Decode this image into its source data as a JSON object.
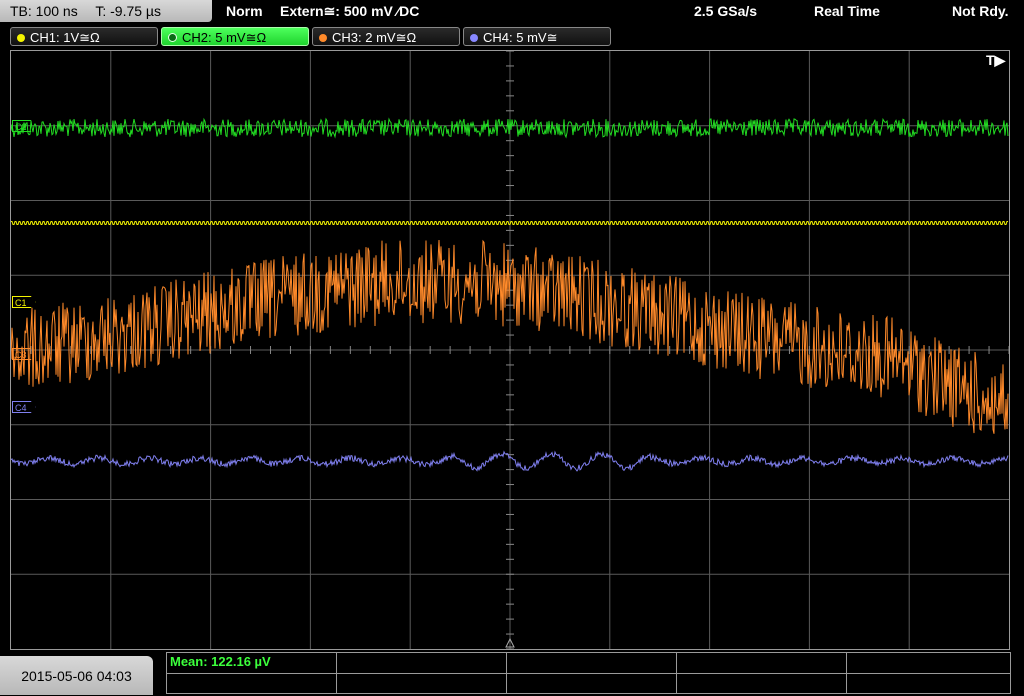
{
  "topbar": {
    "timebase": "TB: 100 ns",
    "trigger_time": "T: -9.75 µs",
    "mode": "Norm",
    "trigger_source": "Extern≅: 500 mV ⁄DC",
    "sample_rate": "2.5 GSa/s",
    "acq_mode": "Real Time",
    "status": "Not Rdy."
  },
  "channels": [
    {
      "label": "CH1: 1V≅Ω",
      "color": "#f4f400",
      "active": false
    },
    {
      "label": "CH2: 5 mV≅Ω",
      "color": "#22dd22",
      "active": true
    },
    {
      "label": "CH3: 2 mV≅Ω",
      "color": "#ff8a2a",
      "active": false
    },
    {
      "label": "CH4: 5 mV≅",
      "color": "#8888ff",
      "active": false
    }
  ],
  "markers": {
    "c2": "C2",
    "c1": "C1",
    "c3": "C3",
    "c4": "C4",
    "trigger": "T▶"
  },
  "footer": {
    "datetime": "2015-05-06 04:03",
    "measurement": "Mean: 122.16 µV"
  },
  "colors": {
    "ch1": "#f4f400",
    "ch2": "#22dd22",
    "ch3": "#ff8a2a",
    "ch4": "#8080f0",
    "grid": "#5a5a5a"
  }
}
